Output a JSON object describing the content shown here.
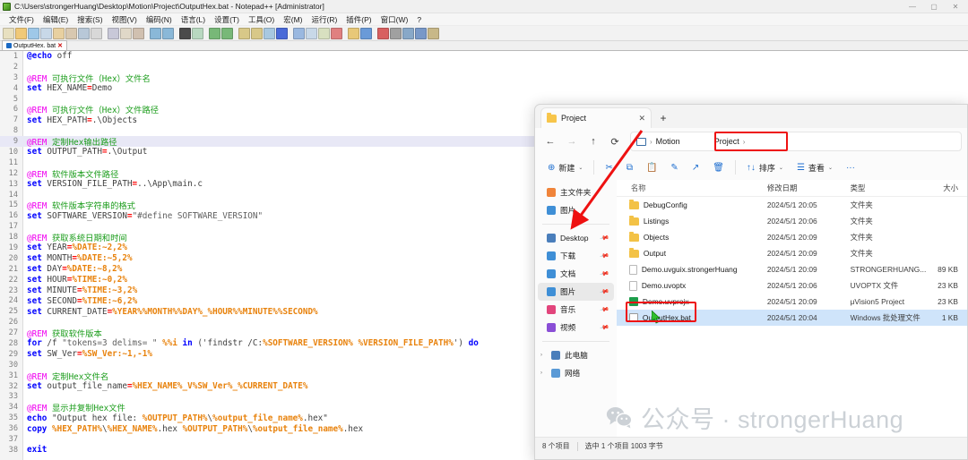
{
  "notepad": {
    "title": "C:\\Users\\strongerHuang\\Desktop\\Motion\\Project\\OutputHex.bat - Notepad++ [Administrator]",
    "window_controls": {
      "minimize": "—",
      "maximize": "▢",
      "close": "✕"
    },
    "menu": [
      "文件(F)",
      "编辑(E)",
      "搜索(S)",
      "视图(V)",
      "编码(N)",
      "语言(L)",
      "设置(T)",
      "工具(O)",
      "宏(M)",
      "运行(R)",
      "插件(P)",
      "窗口(W)",
      "?"
    ],
    "tab": {
      "label": "OutputHex. bat",
      "close": "✕"
    },
    "current_line": 9,
    "lines": [
      {
        "n": 1,
        "segs": [
          {
            "t": "@echo",
            "c": "k-cmd"
          },
          {
            "t": " off",
            "c": "k-txt"
          }
        ]
      },
      {
        "n": 2,
        "segs": []
      },
      {
        "n": 3,
        "segs": [
          {
            "t": "@REM",
            "c": "k-rem"
          },
          {
            "t": " 可执行文件（Hex）文件名",
            "c": "k-cmt"
          }
        ]
      },
      {
        "n": 4,
        "segs": [
          {
            "t": "set",
            "c": "k-cmd"
          },
          {
            "t": " HEX_NAME",
            "c": "k-txt"
          },
          {
            "t": "=",
            "c": "k-op"
          },
          {
            "t": "Demo",
            "c": "k-txt"
          }
        ]
      },
      {
        "n": 5,
        "segs": []
      },
      {
        "n": 6,
        "segs": [
          {
            "t": "@REM",
            "c": "k-rem"
          },
          {
            "t": " 可执行文件（Hex）文件路径",
            "c": "k-cmt"
          }
        ]
      },
      {
        "n": 7,
        "segs": [
          {
            "t": "set",
            "c": "k-cmd"
          },
          {
            "t": " HEX_PATH",
            "c": "k-txt"
          },
          {
            "t": "=",
            "c": "k-op"
          },
          {
            "t": ".\\Objects",
            "c": "k-txt"
          }
        ]
      },
      {
        "n": 8,
        "segs": []
      },
      {
        "n": 9,
        "segs": [
          {
            "t": "@REM",
            "c": "k-rem"
          },
          {
            "t": " 定制Hex输出路径",
            "c": "k-cmt"
          }
        ]
      },
      {
        "n": 10,
        "segs": [
          {
            "t": "set",
            "c": "k-cmd"
          },
          {
            "t": " OUTPUT_PATH",
            "c": "k-txt"
          },
          {
            "t": "=",
            "c": "k-op"
          },
          {
            "t": ".\\Output",
            "c": "k-txt"
          }
        ]
      },
      {
        "n": 11,
        "segs": []
      },
      {
        "n": 12,
        "segs": [
          {
            "t": "@REM",
            "c": "k-rem"
          },
          {
            "t": " 软件版本文件路径",
            "c": "k-cmt"
          }
        ]
      },
      {
        "n": 13,
        "segs": [
          {
            "t": "set",
            "c": "k-cmd"
          },
          {
            "t": " VERSION_FILE_PATH",
            "c": "k-txt"
          },
          {
            "t": "=",
            "c": "k-op"
          },
          {
            "t": "..\\App\\main.c",
            "c": "k-txt"
          }
        ]
      },
      {
        "n": 14,
        "segs": []
      },
      {
        "n": 15,
        "segs": [
          {
            "t": "@REM",
            "c": "k-rem"
          },
          {
            "t": " 软件版本字符串的格式",
            "c": "k-cmt"
          }
        ]
      },
      {
        "n": 16,
        "segs": [
          {
            "t": "set",
            "c": "k-cmd"
          },
          {
            "t": " SOFTWARE_VERSION",
            "c": "k-txt"
          },
          {
            "t": "=",
            "c": "k-op"
          },
          {
            "t": "\"#define SOFTWARE_VERSION\"",
            "c": "k-str"
          }
        ]
      },
      {
        "n": 17,
        "segs": []
      },
      {
        "n": 18,
        "segs": [
          {
            "t": "@REM",
            "c": "k-rem"
          },
          {
            "t": " 获取系统日期和时间",
            "c": "k-cmt"
          }
        ]
      },
      {
        "n": 19,
        "segs": [
          {
            "t": "set",
            "c": "k-cmd"
          },
          {
            "t": " YEAR",
            "c": "k-txt"
          },
          {
            "t": "=",
            "c": "k-op"
          },
          {
            "t": "%DATE:~2,2%",
            "c": "k-var"
          }
        ]
      },
      {
        "n": 20,
        "segs": [
          {
            "t": "set",
            "c": "k-cmd"
          },
          {
            "t": " MONTH",
            "c": "k-txt"
          },
          {
            "t": "=",
            "c": "k-op"
          },
          {
            "t": "%DATE:~5,2%",
            "c": "k-var"
          }
        ]
      },
      {
        "n": 21,
        "segs": [
          {
            "t": "set",
            "c": "k-cmd"
          },
          {
            "t": " DAY",
            "c": "k-txt"
          },
          {
            "t": "=",
            "c": "k-op"
          },
          {
            "t": "%DATE:~8,2%",
            "c": "k-var"
          }
        ]
      },
      {
        "n": 22,
        "segs": [
          {
            "t": "set",
            "c": "k-cmd"
          },
          {
            "t": " HOUR",
            "c": "k-txt"
          },
          {
            "t": "=",
            "c": "k-op"
          },
          {
            "t": "%TIME:~0,2%",
            "c": "k-var"
          }
        ]
      },
      {
        "n": 23,
        "segs": [
          {
            "t": "set",
            "c": "k-cmd"
          },
          {
            "t": " MINUTE",
            "c": "k-txt"
          },
          {
            "t": "=",
            "c": "k-op"
          },
          {
            "t": "%TIME:~3,2%",
            "c": "k-var"
          }
        ]
      },
      {
        "n": 24,
        "segs": [
          {
            "t": "set",
            "c": "k-cmd"
          },
          {
            "t": " SECOND",
            "c": "k-txt"
          },
          {
            "t": "=",
            "c": "k-op"
          },
          {
            "t": "%TIME:~6,2%",
            "c": "k-var"
          }
        ]
      },
      {
        "n": 25,
        "segs": [
          {
            "t": "set",
            "c": "k-cmd"
          },
          {
            "t": " CURRENT_DATE",
            "c": "k-txt"
          },
          {
            "t": "=",
            "c": "k-op"
          },
          {
            "t": "%YEAR%%MONTH%%DAY%_%HOUR%%MINUTE%%SECOND%",
            "c": "k-var"
          }
        ]
      },
      {
        "n": 26,
        "segs": []
      },
      {
        "n": 27,
        "segs": [
          {
            "t": "@REM",
            "c": "k-rem"
          },
          {
            "t": " 获取软件版本",
            "c": "k-cmt"
          }
        ]
      },
      {
        "n": 28,
        "segs": [
          {
            "t": "for",
            "c": "k-cmd"
          },
          {
            "t": " /f ",
            "c": "k-txt"
          },
          {
            "t": "\"tokens=3 delims= \"",
            "c": "k-str"
          },
          {
            "t": " %%i",
            "c": "k-var"
          },
          {
            "t": " in",
            "c": "k-cmd"
          },
          {
            "t": " ('findstr /C:",
            "c": "k-txt"
          },
          {
            "t": "%SOFTWARE_VERSION% %VERSION_FILE_PATH%",
            "c": "k-var"
          },
          {
            "t": "') ",
            "c": "k-txt"
          },
          {
            "t": "do",
            "c": "k-cmd"
          }
        ]
      },
      {
        "n": 29,
        "segs": [
          {
            "t": "set",
            "c": "k-cmd"
          },
          {
            "t": " SW_Ver",
            "c": "k-txt"
          },
          {
            "t": "=",
            "c": "k-op"
          },
          {
            "t": "%SW_Ver:~1,-1%",
            "c": "k-var"
          }
        ]
      },
      {
        "n": 30,
        "segs": []
      },
      {
        "n": 31,
        "segs": [
          {
            "t": "@REM",
            "c": "k-rem"
          },
          {
            "t": " 定制Hex文件名",
            "c": "k-cmt"
          }
        ]
      },
      {
        "n": 32,
        "segs": [
          {
            "t": "set",
            "c": "k-cmd"
          },
          {
            "t": " output_file_name",
            "c": "k-txt"
          },
          {
            "t": "=",
            "c": "k-op"
          },
          {
            "t": "%HEX_NAME%_V%SW_Ver%_%CURRENT_DATE%",
            "c": "k-var"
          }
        ]
      },
      {
        "n": 33,
        "segs": []
      },
      {
        "n": 34,
        "segs": [
          {
            "t": "@REM",
            "c": "k-rem"
          },
          {
            "t": " 显示并复制Hex文件",
            "c": "k-cmt"
          }
        ]
      },
      {
        "n": 35,
        "segs": [
          {
            "t": "echo",
            "c": "k-cmd"
          },
          {
            "t": " \"Output hex file: ",
            "c": "k-txt"
          },
          {
            "t": "%OUTPUT_PATH%",
            "c": "k-var"
          },
          {
            "t": "\\",
            "c": "k-txt"
          },
          {
            "t": "%output_file_name%",
            "c": "k-var"
          },
          {
            "t": ".hex\"",
            "c": "k-txt"
          }
        ]
      },
      {
        "n": 36,
        "segs": [
          {
            "t": "copy",
            "c": "k-cmd"
          },
          {
            "t": " ",
            "c": "k-txt"
          },
          {
            "t": "%HEX_PATH%",
            "c": "k-var"
          },
          {
            "t": "\\",
            "c": "k-txt"
          },
          {
            "t": "%HEX_NAME%",
            "c": "k-var"
          },
          {
            "t": ".hex ",
            "c": "k-txt"
          },
          {
            "t": "%OUTPUT_PATH%",
            "c": "k-var"
          },
          {
            "t": "\\",
            "c": "k-txt"
          },
          {
            "t": "%output_file_name%",
            "c": "k-var"
          },
          {
            "t": ".hex",
            "c": "k-txt"
          }
        ]
      },
      {
        "n": 37,
        "segs": []
      },
      {
        "n": 38,
        "segs": [
          {
            "t": "exit",
            "c": "k-cmd"
          }
        ]
      }
    ]
  },
  "explorer": {
    "tab": {
      "label": "Project",
      "close": "✕"
    },
    "new_tab": "+",
    "nav": {
      "back": "←",
      "forward": "→",
      "up": "↑",
      "refresh": "⟳"
    },
    "breadcrumb": {
      "items": [
        "Motion",
        "Project"
      ],
      "separator": "›"
    },
    "toolbar": [
      {
        "name": "new",
        "label": "新建",
        "icon": "plus-circle-icon",
        "chevron": "⌄"
      },
      {
        "name": "cut",
        "label": "",
        "icon": "scissors-icon",
        "chevron": ""
      },
      {
        "name": "copy",
        "label": "",
        "icon": "copy-icon",
        "chevron": ""
      },
      {
        "name": "paste",
        "label": "",
        "icon": "paste-icon",
        "chevron": ""
      },
      {
        "name": "rename",
        "label": "",
        "icon": "rename-icon",
        "chevron": ""
      },
      {
        "name": "share",
        "label": "",
        "icon": "share-icon",
        "chevron": ""
      },
      {
        "name": "delete",
        "label": "",
        "icon": "trash-icon",
        "chevron": ""
      },
      {
        "name": "sort",
        "label": "排序",
        "icon": "sort-icon",
        "chevron": "⌄"
      },
      {
        "name": "view",
        "label": "查看",
        "icon": "view-icon",
        "chevron": "⌄"
      },
      {
        "name": "more",
        "label": "",
        "icon": "ellipsis-icon",
        "chevron": ""
      }
    ],
    "sidebar": [
      {
        "label": "主文件夹",
        "icon": "home-icon",
        "color": "#f0843a",
        "pinned": false,
        "selected": false,
        "arrow": ""
      },
      {
        "label": "图片",
        "icon": "pictures-icon",
        "color": "#3f8fd6",
        "pinned": false,
        "selected": false,
        "arrow": ""
      },
      {
        "label": "Desktop",
        "icon": "desktop-icon",
        "color": "#4a7ebb",
        "pinned": true,
        "selected": false,
        "arrow": ""
      },
      {
        "label": "下载",
        "icon": "downloads-icon",
        "color": "#3f8fd6",
        "pinned": true,
        "selected": false,
        "arrow": ""
      },
      {
        "label": "文档",
        "icon": "documents-icon",
        "color": "#3f8fd6",
        "pinned": true,
        "selected": false,
        "arrow": ""
      },
      {
        "label": "图片",
        "icon": "pictures-icon",
        "color": "#3f8fd6",
        "pinned": true,
        "selected": true,
        "arrow": ""
      },
      {
        "label": "音乐",
        "icon": "music-icon",
        "color": "#e2457c",
        "pinned": true,
        "selected": false,
        "arrow": ""
      },
      {
        "label": "视频",
        "icon": "videos-icon",
        "color": "#8a4ed6",
        "pinned": true,
        "selected": false,
        "arrow": ""
      },
      {
        "label": "此电脑",
        "icon": "this-pc-icon",
        "color": "#4a7ebb",
        "pinned": false,
        "selected": false,
        "arrow": "›"
      },
      {
        "label": "网络",
        "icon": "network-icon",
        "color": "#5a9ad6",
        "pinned": false,
        "selected": false,
        "arrow": "›"
      }
    ],
    "columns": [
      "名称",
      "修改日期",
      "类型",
      "大小"
    ],
    "files": [
      {
        "name": "DebugConfig",
        "date": "2024/5/1 20:05",
        "type": "文件夹",
        "size": "",
        "icon": "folder",
        "selected": false
      },
      {
        "name": "Listings",
        "date": "2024/5/1 20:06",
        "type": "文件夹",
        "size": "",
        "icon": "folder",
        "selected": false
      },
      {
        "name": "Objects",
        "date": "2024/5/1 20:09",
        "type": "文件夹",
        "size": "",
        "icon": "folder",
        "selected": false
      },
      {
        "name": "Output",
        "date": "2024/5/1 20:09",
        "type": "文件夹",
        "size": "",
        "icon": "folder",
        "selected": false
      },
      {
        "name": "Demo.uvguix.strongerHuang",
        "date": "2024/5/1 20:09",
        "type": "STRONGERHUANG...",
        "size": "89 KB",
        "icon": "doc",
        "selected": false
      },
      {
        "name": "Demo.uvoptx",
        "date": "2024/5/1 20:06",
        "type": "UVOPTX 文件",
        "size": "23 KB",
        "icon": "doc",
        "selected": false
      },
      {
        "name": "Demo.uvprojx",
        "date": "2024/5/1 20:09",
        "type": "μVision5 Project",
        "size": "23 KB",
        "icon": "uv",
        "selected": false
      },
      {
        "name": "OutputHex.bat",
        "date": "2024/5/1 20:04",
        "type": "Windows 批处理文件",
        "size": "1 KB",
        "icon": "bat",
        "selected": true
      }
    ],
    "status": {
      "count": "8 个项目",
      "selection": "选中 1 个项目  1003 字节"
    }
  },
  "watermark": {
    "text": "公众号 · strongerHuang",
    "icon": "wechat-icon"
  },
  "annotations": {
    "highlight_color": "#ee1111",
    "breadcrumb_highlight": "Project",
    "file_highlight": "OutputHex.bat",
    "arrow": "red-arrow-pointing-to-outputhex-bat"
  }
}
